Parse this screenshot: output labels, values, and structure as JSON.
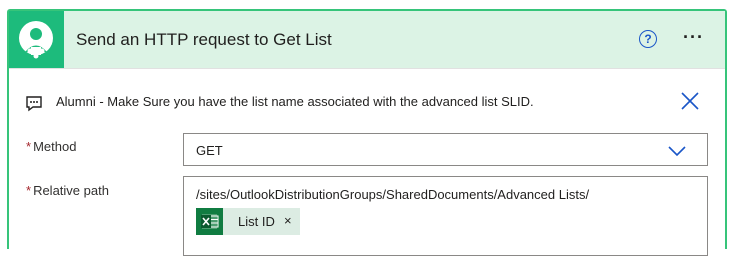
{
  "header": {
    "title": "Send an HTTP request to Get List",
    "app_icon": "sharepoint-user-puzzle-icon",
    "help_icon": "question-circle-icon",
    "help_glyph": "?",
    "more_icon": "ellipsis-icon",
    "more_glyph": "···"
  },
  "notice": {
    "icon": "comment-icon",
    "text": "Alumni - Make Sure you have the list name associated with the advanced list SLID.",
    "close_icon": "close-icon"
  },
  "fields": {
    "method": {
      "required_mark": "*",
      "label": "Method",
      "value": "GET",
      "dropdown_icon": "chevron-down-icon"
    },
    "relative_path": {
      "required_mark": "*",
      "label": "Relative path",
      "value": "/sites/OutlookDistributionGroups/SharedDocuments/Advanced Lists/",
      "token": {
        "icon": "excel-icon",
        "label": "List ID",
        "remove_glyph": "×"
      }
    }
  },
  "colors": {
    "border_accent": "#36c47a",
    "header_bg": "#dcf3e5",
    "app_tile": "#1dbb7c",
    "link_blue": "#1a56c8",
    "required_red": "#a4262c",
    "excel_green": "#107c41",
    "chip_bg": "#dcece3"
  }
}
